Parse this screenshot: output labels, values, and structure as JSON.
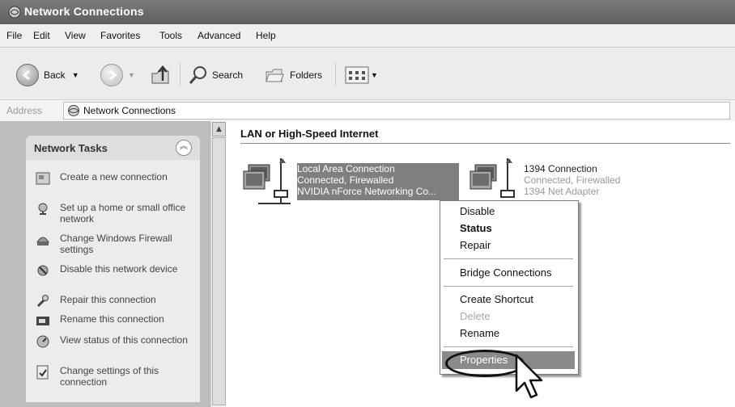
{
  "window": {
    "title": "Network Connections"
  },
  "menu": [
    "File",
    "Edit",
    "View",
    "Favorites",
    "Tools",
    "Advanced",
    "Help"
  ],
  "toolbar": {
    "back_label": "Back",
    "search_label": "Search",
    "folders_label": "Folders"
  },
  "address": {
    "label": "Address",
    "value": "Network Connections"
  },
  "tasks": {
    "title": "Network Tasks",
    "items": [
      {
        "label": "Create a new connection",
        "icon": "new-connection-icon"
      },
      {
        "label": "Set up a home or small office network",
        "icon": "home-network-icon"
      },
      {
        "label": "Change Windows Firewall settings",
        "icon": "firewall-icon"
      },
      {
        "label": "Disable this network device",
        "icon": "disable-device-icon"
      },
      {
        "label": "Repair this connection",
        "icon": "repair-icon"
      },
      {
        "label": "Rename this connection",
        "icon": "rename-icon"
      },
      {
        "label": "View status of this connection",
        "icon": "status-icon"
      },
      {
        "label": "Change settings of this connection",
        "icon": "settings-icon"
      }
    ]
  },
  "main": {
    "section_title": "LAN or High-Speed Internet",
    "connections": [
      {
        "name": "Local Area Connection",
        "status": "Connected, Firewalled",
        "device": "NVIDIA nForce Networking Co...",
        "selected": true
      },
      {
        "name": "1394 Connection",
        "status": "Connected, Firewalled",
        "device": "1394 Net Adapter",
        "selected": false
      }
    ]
  },
  "context_menu": {
    "items": [
      {
        "label": "Disable"
      },
      {
        "label": "Status",
        "bold": true
      },
      {
        "label": "Repair"
      },
      {
        "label": "Bridge Connections"
      },
      {
        "label": "Create Shortcut"
      },
      {
        "label": "Delete",
        "disabled": true
      },
      {
        "label": "Rename"
      },
      {
        "label": "Properties",
        "highlighted": true
      }
    ]
  }
}
